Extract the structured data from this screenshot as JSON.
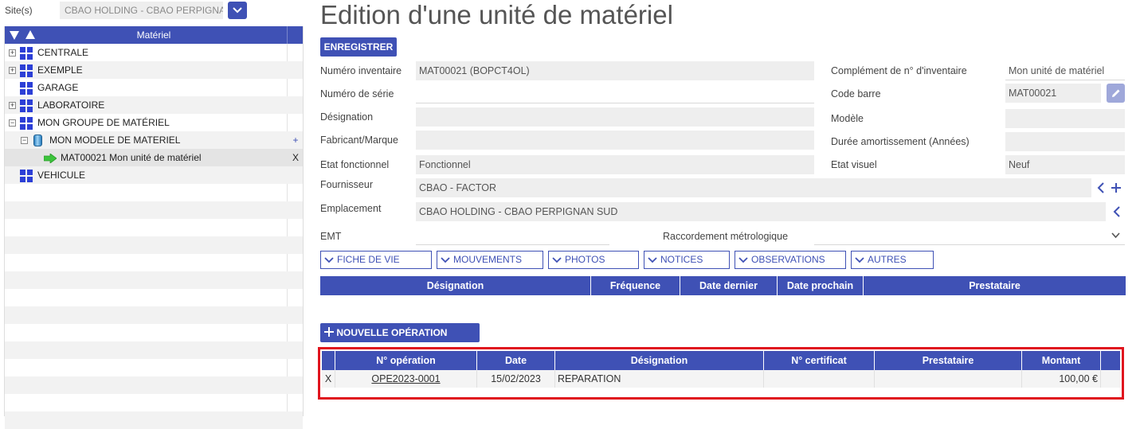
{
  "site": {
    "label": "Site(s)",
    "value": "CBAO HOLDING - CBAO PERPIGNA"
  },
  "tree": {
    "header": "Matériel",
    "items": [
      {
        "label": "CENTRALE",
        "icon": "grid-icon",
        "expander": "+"
      },
      {
        "label": "EXEMPLE",
        "icon": "grid-icon",
        "expander": "+"
      },
      {
        "label": "GARAGE",
        "icon": "grid-icon",
        "expander": ""
      },
      {
        "label": "LABORATOIRE",
        "icon": "grid-icon",
        "expander": "+"
      },
      {
        "label": "MON GROUPE DE MATÉRIEL",
        "icon": "grid-icon",
        "expander": "−"
      },
      {
        "label": "MON MODELE DE MATERIEL",
        "icon": "cylinder-icon",
        "expander": "−",
        "action": "+"
      },
      {
        "label": "MAT00021 Mon unité de matériel",
        "icon": "green-arrow-icon",
        "action": "X"
      },
      {
        "label": "VEHICULE",
        "icon": "grid-icon",
        "expander": ""
      }
    ]
  },
  "page": {
    "title": "Edition d'une unité de matériel",
    "save_label": "ENREGISTRER"
  },
  "form": {
    "numero_inventaire": {
      "label": "Numéro inventaire",
      "value": "MAT00021 (BOPCT4OL)"
    },
    "complement": {
      "label": "Complément de n° d'inventaire",
      "value": "Mon unité de matériel"
    },
    "numero_serie": {
      "label": "Numéro de série",
      "value": ""
    },
    "code_barre": {
      "label": "Code barre",
      "value": "MAT00021"
    },
    "designation": {
      "label": "Désignation",
      "value": ""
    },
    "modele": {
      "label": "Modèle",
      "value": ""
    },
    "fabricant": {
      "label": "Fabricant/Marque",
      "value": ""
    },
    "duree": {
      "label": "Durée amortissement (Années)",
      "value": ""
    },
    "etat_fonctionnel": {
      "label": "Etat fonctionnel",
      "value": "Fonctionnel"
    },
    "etat_visuel": {
      "label": "Etat visuel",
      "value": "Neuf"
    },
    "fournisseur": {
      "label": "Fournisseur",
      "value": "CBAO - FACTOR"
    },
    "emplacement": {
      "label": "Emplacement",
      "value": "CBAO HOLDING - CBAO PERPIGNAN SUD"
    },
    "emt": {
      "label": "EMT",
      "value": ""
    },
    "raccordement": {
      "label": "Raccordement métrologique",
      "value": ""
    }
  },
  "tabs": [
    "FICHE DE VIE",
    "MOUVEMENTS",
    "PHOTOS",
    "NOTICES",
    "OBSERVATIONS",
    "AUTRES"
  ],
  "schedule_table": {
    "columns": [
      "Désignation",
      "Fréquence",
      "Date dernier",
      "Date prochain",
      "Prestataire"
    ]
  },
  "new_operation_label": "NOUVELLE OPÉRATION",
  "operations": {
    "columns": [
      "N° opération",
      "Date",
      "Désignation",
      "N° certificat",
      "Prestataire",
      "Montant"
    ],
    "rows": [
      {
        "delete": "X",
        "numero": "OPE2023-0001",
        "date": "15/02/2023",
        "designation": "REPARATION",
        "certificat": "",
        "prestataire": "",
        "montant": "100,00 €"
      }
    ]
  },
  "colors": {
    "primary": "#3f51b5",
    "highlight": "#e0141e",
    "field_bg": "#eeeeee"
  }
}
